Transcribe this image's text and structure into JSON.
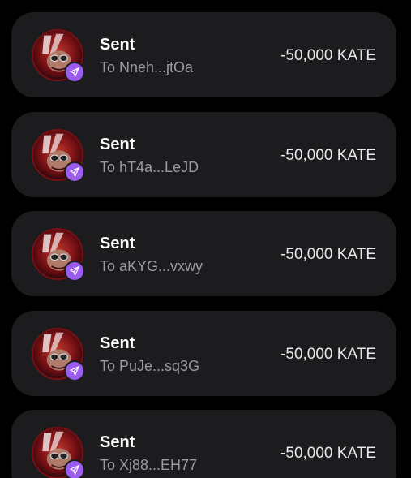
{
  "colors": {
    "background": "#000000",
    "card": "#1c1c1e",
    "badge": "#9d5cf0",
    "title": "#ffffff",
    "subtitle": "#9a9aa0",
    "amount": "#e8e8ea"
  },
  "transactions": [
    {
      "title": "Sent",
      "subtitle": "To Nneh...jtOa",
      "amount": "-50,000 KATE",
      "avatar_icon": "token-avatar",
      "badge_icon": "send-icon"
    },
    {
      "title": "Sent",
      "subtitle": "To hT4a...LeJD",
      "amount": "-50,000 KATE",
      "avatar_icon": "token-avatar",
      "badge_icon": "send-icon"
    },
    {
      "title": "Sent",
      "subtitle": "To aKYG...vxwy",
      "amount": "-50,000 KATE",
      "avatar_icon": "token-avatar",
      "badge_icon": "send-icon"
    },
    {
      "title": "Sent",
      "subtitle": "To PuJe...sq3G",
      "amount": "-50,000 KATE",
      "avatar_icon": "token-avatar",
      "badge_icon": "send-icon"
    },
    {
      "title": "Sent",
      "subtitle": "To Xj88...EH77",
      "amount": "-50,000 KATE",
      "avatar_icon": "token-avatar",
      "badge_icon": "send-icon"
    }
  ]
}
